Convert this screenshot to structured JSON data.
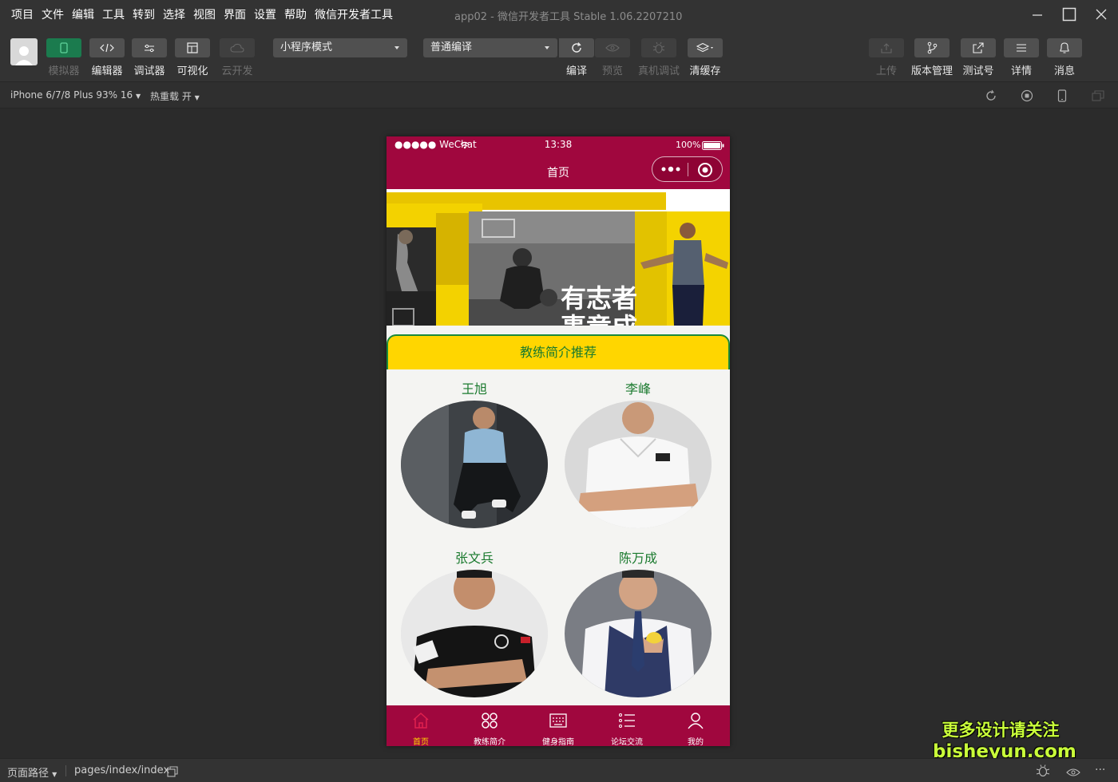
{
  "menu": [
    "项目",
    "文件",
    "编辑",
    "工具",
    "转到",
    "选择",
    "视图",
    "界面",
    "设置",
    "帮助",
    "微信开发者工具"
  ],
  "window": {
    "title": "app02 - 微信开发者工具 Stable 1.06.2207210"
  },
  "toolbar": {
    "simulator": "模拟器",
    "editor": "编辑器",
    "debugger": "调试器",
    "visual": "可视化",
    "cloud": "云开发",
    "mode_select": "小程序模式",
    "compile_select": "普通编译",
    "compile": "编译",
    "preview": "预览",
    "real_debug": "真机调试",
    "clear_cache": "清缓存",
    "upload": "上传",
    "version": "版本管理",
    "test_account": "测试号",
    "details": "详情",
    "messages": "消息"
  },
  "subbar": {
    "device": "iPhone 6/7/8 Plus 93% 16",
    "hot_reload": "热重载 开"
  },
  "phone": {
    "carrier": "●●●●● WeChat",
    "time": "13:38",
    "battery": "100%",
    "nav_title": "首页",
    "banner_text_1": "有志者",
    "banner_text_2": "事竟成",
    "section_title": "教练简介推荐",
    "coaches": [
      {
        "name": "王旭"
      },
      {
        "name": "李峰"
      },
      {
        "name": "张文兵"
      },
      {
        "name": "陈万成"
      }
    ],
    "tabs": [
      {
        "label": "首页",
        "icon": "home-icon",
        "active": true
      },
      {
        "label": "教练简介",
        "icon": "grid-icon",
        "active": false
      },
      {
        "label": "健身指南",
        "icon": "keyboard-icon",
        "active": false
      },
      {
        "label": "论坛交流",
        "icon": "list-icon",
        "active": false
      },
      {
        "label": "我的",
        "icon": "user-icon",
        "active": false
      }
    ]
  },
  "bottombar": {
    "page_path_label": "页面路径",
    "page_path": "pages/index/index"
  },
  "watermark": {
    "line1": "更多设计请关注",
    "line2": "bisheyun.com"
  },
  "colors": {
    "accent": "#a0073e",
    "section_bg": "#ffd600",
    "green_text": "#1a7a2e",
    "simulator_button": "#1b7b4e"
  }
}
